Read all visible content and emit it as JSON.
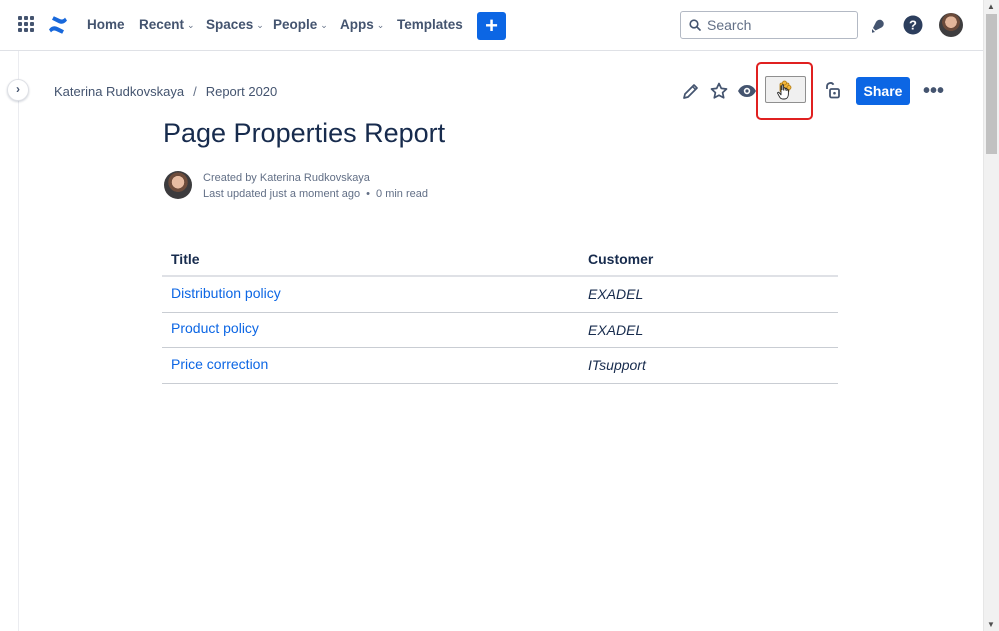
{
  "nav": {
    "items": [
      {
        "label": "Home",
        "dropdown": false
      },
      {
        "label": "Recent",
        "dropdown": true
      },
      {
        "label": "Spaces",
        "dropdown": true
      },
      {
        "label": "People",
        "dropdown": true
      },
      {
        "label": "Apps",
        "dropdown": true
      },
      {
        "label": "Templates",
        "dropdown": false
      }
    ],
    "create_label": "+",
    "search_placeholder": "Search"
  },
  "breadcrumb": {
    "items": [
      "Katerina Rudkovskaya",
      "Report 2020"
    ],
    "separator": "/"
  },
  "toolbar": {
    "share_label": "Share",
    "more_label": "•••"
  },
  "page": {
    "title": "Page Properties Report",
    "created_by": "Created by Katerina Rudkovskaya",
    "last_updated": "Last updated just a moment ago",
    "dot": "•",
    "read_time": "0 min read"
  },
  "table": {
    "headers": [
      "Title",
      "Customer"
    ],
    "rows": [
      {
        "title": "Distribution policy",
        "customer": "EXADEL"
      },
      {
        "title": "Product policy",
        "customer": "EXADEL"
      },
      {
        "title": "Price correction",
        "customer": "ITsupport"
      }
    ]
  },
  "colors": {
    "accent": "#0c66e4",
    "highlight": "#e02020",
    "text": "#172b4d",
    "subtle": "#44546f"
  }
}
